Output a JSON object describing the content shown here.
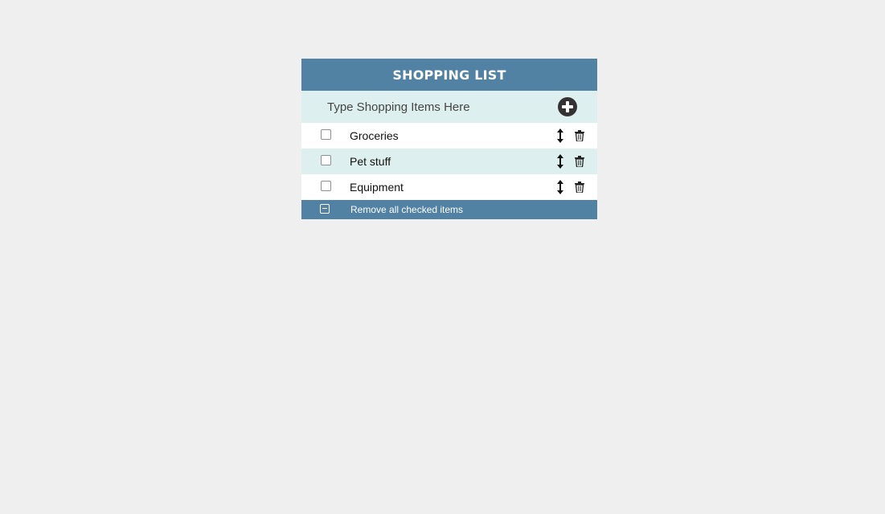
{
  "app": {
    "title": "SHOPPING LIST"
  },
  "entry": {
    "placeholder": "Type Shopping Items Here",
    "add_icon": "plus-circle-icon"
  },
  "items": [
    {
      "label": "Groceries",
      "checked": false,
      "move_icon": "vertical-arrows-icon",
      "delete_icon": "trash-icon"
    },
    {
      "label": "Pet stuff",
      "checked": false,
      "move_icon": "vertical-arrows-icon",
      "delete_icon": "trash-icon"
    },
    {
      "label": "Equipment",
      "checked": false,
      "move_icon": "vertical-arrows-icon",
      "delete_icon": "trash-icon"
    }
  ],
  "footer": {
    "label": "Remove all checked items",
    "icon": "minus-square-icon"
  },
  "colors": {
    "page_background": "#efefef",
    "header": "#5182a3",
    "alt_row": "#ddf0ef",
    "row": "#ffffff",
    "add_button": "#333333"
  }
}
